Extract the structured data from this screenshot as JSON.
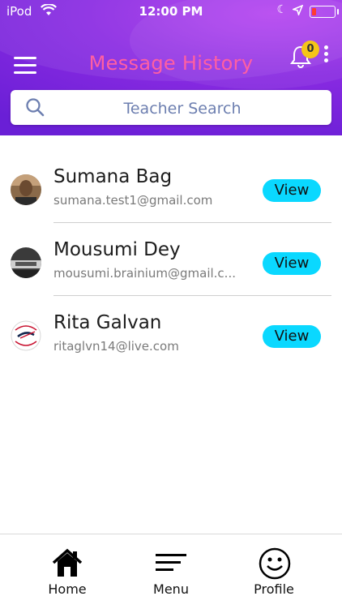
{
  "status_bar": {
    "carrier": "iPod",
    "time": "12:00 PM"
  },
  "header": {
    "title": "Message History",
    "notification_count": "0",
    "accent_title_color": "#ff5fa2"
  },
  "search": {
    "placeholder": "Teacher Search"
  },
  "contacts": [
    {
      "name": "Sumana Bag",
      "email": "sumana.test1@gmail.com",
      "action": "View"
    },
    {
      "name": "Mousumi Dey",
      "email": "mousumi.brainium@gmail.c...",
      "action": "View"
    },
    {
      "name": "Rita Galvan",
      "email": "ritaglvn14@live.com",
      "action": "View"
    }
  ],
  "tabbar": {
    "home": "Home",
    "menu": "Menu",
    "profile": "Profile"
  },
  "colors": {
    "view_button": "#0ad8ff",
    "header_purple": "#8a2be2",
    "badge": "#f5c518"
  }
}
